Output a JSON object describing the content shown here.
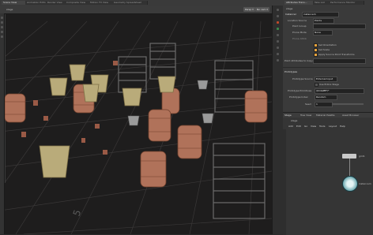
{
  "tabs": [
    "Scene View",
    "Animation Editor",
    "Render View",
    "Composite View",
    "Motion FX View",
    "Geometry Spreadsheet"
  ],
  "right_tabs": [
    "Attributes Trans...",
    "Take List",
    "Performance Monitor"
  ],
  "viewport": {
    "path": "stage",
    "persp_label": "Persp ▾",
    "cam_label": "No cam ▾",
    "grid_number": "5"
  },
  "params": {
    "node_type": "Instancer",
    "node_name": "instancer1",
    "rows": [
      {
        "label": "Location Source",
        "value": "Points"
      },
      {
        "label": "Point Group",
        "value": ""
      },
      {
        "label": "Prune Mode",
        "value": "None"
      },
      {
        "label": "Prune Attrib",
        "value": ""
      }
    ],
    "checks": [
      "Set Orientation",
      "Set Scale",
      "Apply Source Point Transforms"
    ],
    "point_attr_label": "Point Attributes to Copy",
    "section": "Prototypes",
    "proto_source_label": "Prototype Source",
    "proto_source_value": "External Input",
    "entire_stage_label": "Use Entire Stage",
    "proto_prim_label": "Prototype Primitives",
    "proto_prim_value": "/$hdaPEF/*",
    "proto_index_label": "Prototype Index",
    "proto_index_value": "Random",
    "seed_label": "Seed",
    "seed_value": "1"
  },
  "network": {
    "tabs": [
      "Stage",
      "Tree View",
      "Material Palette",
      "Asset Browser"
    ],
    "path": "stage",
    "menu": [
      "Add",
      "Edit",
      "Go",
      "View",
      "Tools",
      "Layout",
      "Help"
    ],
    "nodes": [
      {
        "name": "grid1"
      },
      {
        "name": "instancer1"
      }
    ]
  }
}
